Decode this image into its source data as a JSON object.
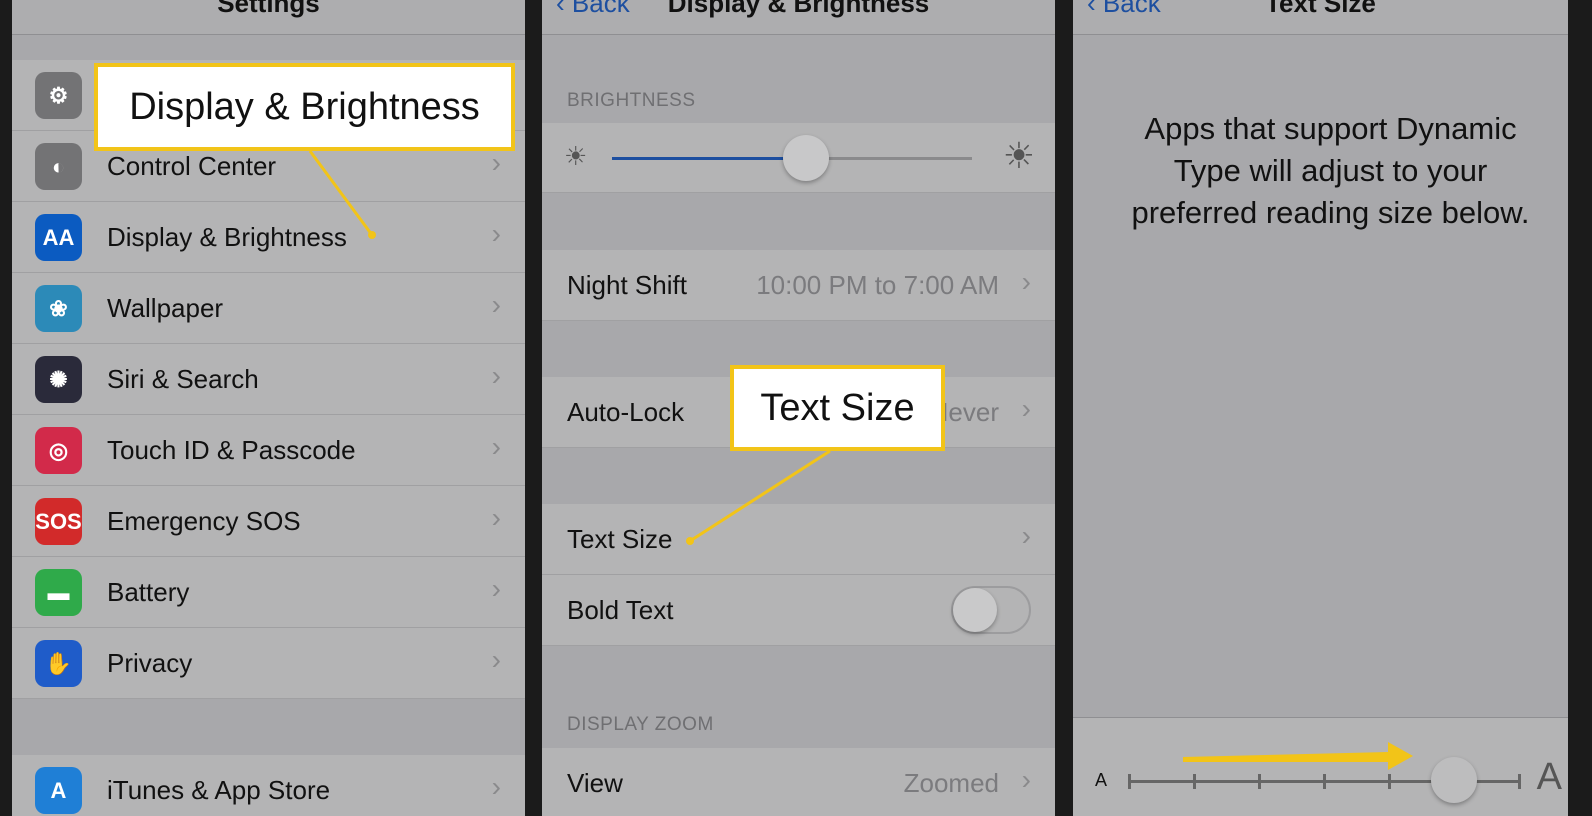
{
  "panel1": {
    "title": "Settings",
    "items": [
      {
        "label": "General",
        "icon": "gear-icon",
        "color": "#737375",
        "glyph": "⚙"
      },
      {
        "label": "Control Center",
        "icon": "toggles-icon",
        "color": "#737375",
        "glyph": "◐"
      },
      {
        "label": "Display & Brightness",
        "icon": "text-size-icon",
        "color": "#0b5bc1",
        "glyph": "AA"
      },
      {
        "label": "Wallpaper",
        "icon": "flower-icon",
        "color": "#2c8ab8",
        "glyph": "❀"
      },
      {
        "label": "Siri & Search",
        "icon": "siri-icon",
        "color": "#2a2a3a",
        "glyph": "✺"
      },
      {
        "label": "Touch ID & Passcode",
        "icon": "fingerprint-icon",
        "color": "#d22a4a",
        "glyph": "◎"
      },
      {
        "label": "Emergency SOS",
        "icon": "sos-icon",
        "color": "#d22a2a",
        "glyph": "SOS"
      },
      {
        "label": "Battery",
        "icon": "battery-icon",
        "color": "#2faa4a",
        "glyph": "▬"
      },
      {
        "label": "Privacy",
        "icon": "hand-icon",
        "color": "#1f5cc9",
        "glyph": "✋"
      },
      {
        "label": "iTunes & App Store",
        "icon": "app-store-icon",
        "color": "#1f7fd6",
        "glyph": "A"
      }
    ],
    "callout": "Display & Brightness"
  },
  "panel2": {
    "back": "Back",
    "title": "Display & Brightness",
    "brightness_header": "BRIGHTNESS",
    "brightness_level": 0.54,
    "night_shift": {
      "label": "Night Shift",
      "value": "10:00 PM to 7:00 AM"
    },
    "auto_lock": {
      "label": "Auto-Lock",
      "value": "Never"
    },
    "text_size": {
      "label": "Text Size"
    },
    "bold_text": {
      "label": "Bold Text",
      "on": false
    },
    "zoom_header": "DISPLAY ZOOM",
    "view": {
      "label": "View",
      "value": "Zoomed"
    },
    "callout": "Text Size"
  },
  "panel3": {
    "back": "Back",
    "title": "Text Size",
    "description": "Apps that support Dynamic Type will adjust to your preferred reading size below.",
    "small_a": "A",
    "large_a": "A",
    "slider_steps": 7,
    "slider_index": 5
  },
  "colors": {
    "accent": "#1d4fa0",
    "callout_border": "#f2c418"
  }
}
